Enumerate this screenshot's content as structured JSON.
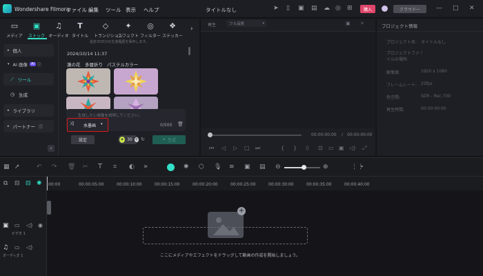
{
  "app": {
    "name": "Wondershare Filmora",
    "project_title": "タイトルなし",
    "menu": [
      "ファイル",
      "編集",
      "ツール",
      "表示",
      "ヘルプ"
    ],
    "buy_label": "購入",
    "cloud_label": "クラウドー"
  },
  "media_tabs": [
    {
      "label": "メディア",
      "icon": "media-icon"
    },
    {
      "label": "ストック",
      "icon": "stock-icon",
      "active": true
    },
    {
      "label": "オーディオ",
      "icon": "audio-icon"
    },
    {
      "label": "タイトル",
      "icon": "title-icon"
    },
    {
      "label": "トランジション",
      "icon": "transition-icon"
    },
    {
      "label": "エフェクト",
      "icon": "effect-icon"
    },
    {
      "label": "フィルター",
      "icon": "filter-icon"
    },
    {
      "label": "ステッカー",
      "icon": "sticker-icon"
    }
  ],
  "sidebar": {
    "personal": "個人",
    "ai_image": "AI 画像",
    "ai_badge": "AI",
    "tool": "ツール",
    "generate": "生成",
    "library": "ライブラリ",
    "partner": "パートナー"
  },
  "generation": {
    "notice": "過去30日分の生成履歴を保存します。",
    "timestamp": "2024/10/14 11:37",
    "tags": [
      "蓮の花",
      "多層折り",
      "パステルカラー"
    ],
    "prompt_placeholder": "生成したい画像を説明してください。",
    "style_label": "水墨画",
    "char_count": "0/500",
    "settings_label": "設定",
    "credits": "30",
    "generate_label": "生成"
  },
  "preview": {
    "player_label": "再生",
    "quality_label": "フル品質",
    "time_current": "00:00:00:00",
    "time_total": "00:00:00:00"
  },
  "properties": {
    "header": "プロジェクト情報",
    "rows": [
      {
        "label": "プロジェクト名:",
        "value": "タイトルなし"
      },
      {
        "label": "プロジェクトファイルの場所:",
        "value": "/"
      },
      {
        "label": "解像度:",
        "value": "1920 x 1080"
      },
      {
        "label": "フレームレート:",
        "value": "25fps"
      },
      {
        "label": "色空間:",
        "value": "SDR - Rec.709"
      },
      {
        "label": "再生時間:",
        "value": "00:00:00:00"
      }
    ]
  },
  "timeline": {
    "ticks": [
      "00:00",
      "00:00:05:00",
      "00:00:10:00",
      "00:00:15:00",
      "00:00:20:00",
      "00:00:25:00",
      "00:00:30:00",
      "00:00:35:00",
      "00:00:40:00"
    ],
    "video_track": "ビデオ 1",
    "audio_track": "オーディオ 1",
    "drop_hint": "ここにメディアやエフェクトをドラッグして動画の作成を開始しましょう。"
  },
  "colors": {
    "accent": "#33e0c8",
    "highlight_box": "#e01818",
    "buy": "#e0466a"
  }
}
